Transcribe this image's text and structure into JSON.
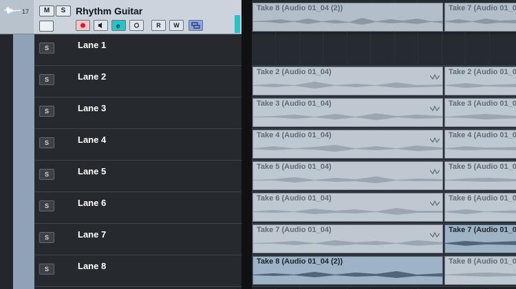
{
  "track": {
    "number": "17",
    "name": "Rhythm Guitar",
    "buttons": {
      "mute": "M",
      "solo": "S",
      "read": "R",
      "write": "W"
    }
  },
  "lanes": [
    {
      "label": "Lane 1",
      "solo": "S"
    },
    {
      "label": "Lane 2",
      "solo": "S"
    },
    {
      "label": "Lane 3",
      "solo": "S"
    },
    {
      "label": "Lane 4",
      "solo": "S"
    },
    {
      "label": "Lane 5",
      "solo": "S"
    },
    {
      "label": "Lane 6",
      "solo": "S"
    },
    {
      "label": "Lane 7",
      "solo": "S"
    },
    {
      "label": "Lane 8",
      "solo": "S"
    }
  ],
  "events": {
    "track_left": "Take 8 (Audio 01_04 (2))",
    "track_right": "Take 7 (Audio 01_0",
    "lane2_left": "Take 2 (Audio 01_04)",
    "lane2_right": "Take 2 (Audio 01_0",
    "lane3_left": "Take 3 (Audio 01_04)",
    "lane3_right": "Take 3 (Audio 01_0",
    "lane4_left": "Take 4 (Audio 01_04)",
    "lane4_right": "Take 4 (Audio 01_0",
    "lane5_left": "Take 5 (Audio 01_04)",
    "lane5_right": "Take 5 (Audio 01_0",
    "lane6_left": "Take 6 (Audio 01_04)",
    "lane6_right": "Take 6 (Audio 01_0",
    "lane7_left": "Take 7 (Audio 01_04)",
    "lane7_right": "Take 7 (Audio 01_0",
    "lane8_left": "Take 8 (Audio 01_04 (2))",
    "lane8_right": "Take 8 (Audio 01_0"
  },
  "colors": {
    "accent_cyan": "#27c3c7",
    "record_red": "#d21f2a",
    "selected_event": "#9fb3c7",
    "event": "#bfc8d1"
  },
  "icons": {
    "track_type": "audio-waveform-icon",
    "record": "record-icon",
    "monitor": "speaker-icon",
    "edit": "edit-e-icon",
    "dot": "circle-icon",
    "lanes": "lanes-icon"
  }
}
